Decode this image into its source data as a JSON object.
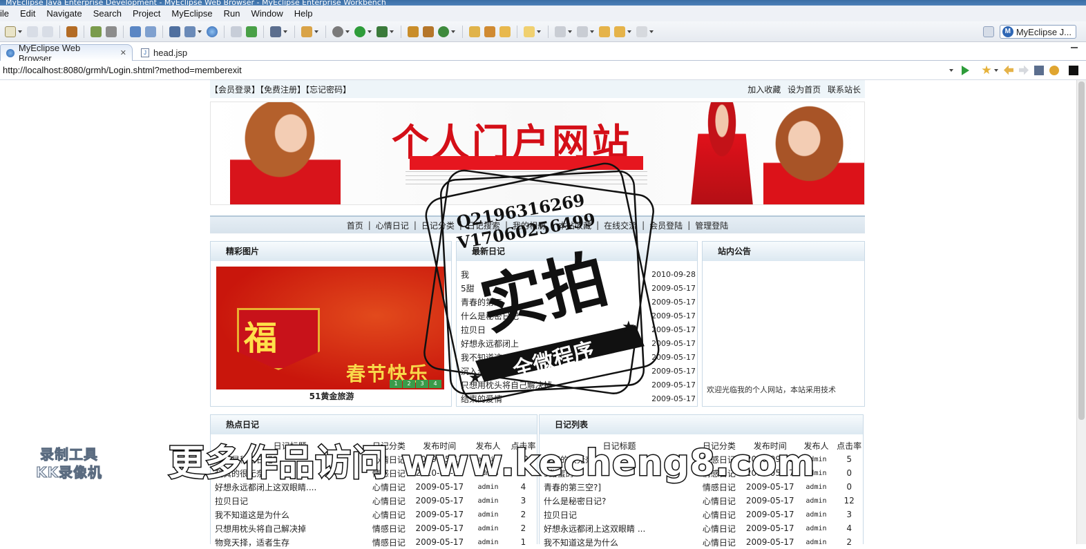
{
  "window": {
    "title": "MyEclipse Java Enterprise Development - MyEclipse Web Browser - MyEclipse Enterprise Workbench"
  },
  "menu": [
    "ile",
    "Edit",
    "Navigate",
    "Search",
    "Project",
    "MyEclipse",
    "Run",
    "Window",
    "Help"
  ],
  "perspective": {
    "label": "MyEclipse J..."
  },
  "tabs": [
    {
      "label": "MyEclipse Web Browser",
      "close": "✕"
    },
    {
      "label": "head.jsp"
    }
  ],
  "browser": {
    "url": "http://localhost:8080/grmh/Login.shtml?method=memberexit"
  },
  "site": {
    "top_links": "【会员登录】【免费注册】【忘记密码】",
    "top_right": [
      "加入收藏",
      "设为首页",
      "联系站长"
    ],
    "banner_title": "个人门户网站",
    "nav": [
      "首页",
      "心情日记",
      "日记分类",
      "日记搜索",
      "我的相册",
      "本站收藏",
      "在线交流",
      "会员登陆",
      "管理登陆"
    ],
    "pics": {
      "title": "精彩图片",
      "fu": "福",
      "greeting": "春节快乐",
      "pager": [
        "1",
        "2",
        "3",
        "4"
      ],
      "caption": "51黄金旅游"
    },
    "latest": {
      "title": "最新日记",
      "rows": [
        {
          "title": "我",
          "date": "2010-09-28"
        },
        {
          "title": "5甜",
          "date": "2009-05-17"
        },
        {
          "title": "青春的第三",
          "date": "2009-05-17"
        },
        {
          "title": "什么是秘密日记",
          "date": "2009-05-17"
        },
        {
          "title": "拉贝日",
          "date": "2009-05-17"
        },
        {
          "title": "好想永远都闭上",
          "date": "2009-05-17"
        },
        {
          "title": "我不知道这",
          "date": "2009-05-17"
        },
        {
          "title": "沉入海底的",
          "date": "2009-05-17"
        },
        {
          "title": "只想用枕头将自己解决掉",
          "date": "2009-05-17"
        },
        {
          "title": "结束的爱情",
          "date": "2009-05-17"
        }
      ]
    },
    "notice": {
      "title": "站内公告",
      "marquee": "欢迎光临我的个人网站，本站采用技术"
    },
    "hot": {
      "title": "热点日记",
      "headers": [
        "日记标题",
        "日记分类",
        "发布时间",
        "发布人",
        "点击率"
      ],
      "rows": [
        [
          "什么是秘密日记？",
          "心情日记",
          "2009-05-17",
          "admin",
          "12"
        ],
        [
          "我真的很无奈",
          "情感日记",
          "2010-09-28",
          "admin",
          "5"
        ],
        [
          "好想永远都闭上这双眼睛....",
          "心情日记",
          "2009-05-17",
          "admin",
          "4"
        ],
        [
          "拉贝日记",
          "心情日记",
          "2009-05-17",
          "admin",
          "3"
        ],
        [
          "我不知道这是为什么",
          "心情日记",
          "2009-05-17",
          "admin",
          "2"
        ],
        [
          "只想用枕头将自己解决掉",
          "情感日记",
          "2009-05-17",
          "admin",
          "2"
        ],
        [
          "物竞天择，适者生存",
          "情感日记",
          "2009-05-17",
          "admin",
          "1"
        ]
      ]
    },
    "list": {
      "title": "日记列表",
      "headers": [
        "日记标题",
        "日记分类",
        "发布时间",
        "发布人",
        "点击率"
      ],
      "rows": [
        [
          "我真的很无奈",
          "情感日记",
          "2010-09-28",
          "admin",
          "5"
        ],
        [
          "5甜蜜的",
          "情感日记",
          "2009-05-17",
          "admin",
          "0"
        ],
        [
          "青春的第三空?]",
          "情感日记",
          "2009-05-17",
          "admin",
          "0"
        ],
        [
          "什么是秘密日记?",
          "心情日记",
          "2009-05-17",
          "admin",
          "12"
        ],
        [
          "拉贝日记",
          "心情日记",
          "2009-05-17",
          "admin",
          "3"
        ],
        [
          "好想永远都闭上这双眼睛 ...",
          "心情日记",
          "2009-05-17",
          "admin",
          "4"
        ],
        [
          "我不知道这是为什么",
          "心情日记",
          "2009-05-17",
          "admin",
          "2"
        ]
      ]
    }
  },
  "overlays": {
    "stamp_phone1": "Q2196316269",
    "stamp_phone2": "V17060256499",
    "stamp_big": "实拍",
    "stamp_ribbon": "全微程序",
    "recorder_line1": "录制工具",
    "recorder_line2": "KK录像机",
    "promo": "更多作品访问 www.kecheng8.com"
  }
}
